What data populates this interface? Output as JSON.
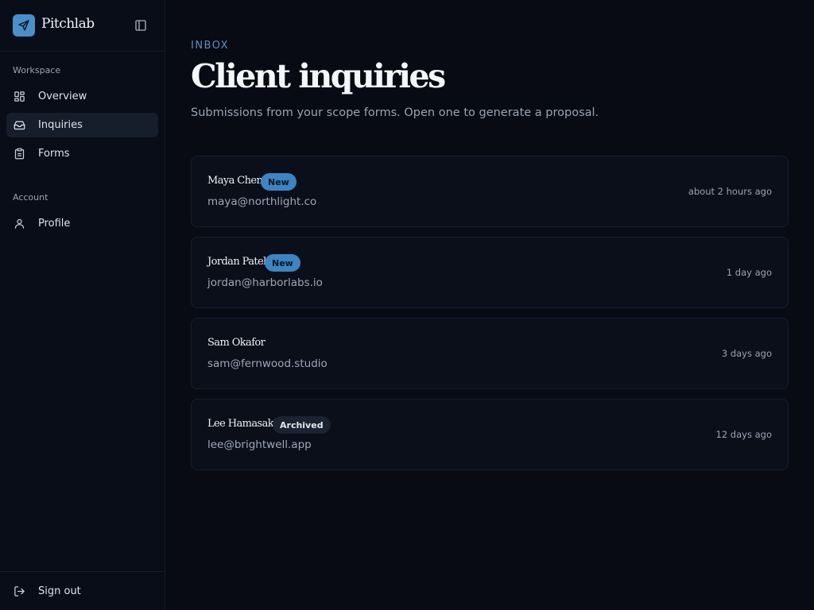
{
  "brand": {
    "name": "Pitchlab"
  },
  "sidebar": {
    "sections": [
      {
        "label": "Workspace",
        "items": [
          {
            "label": "Overview",
            "icon": "grid-icon"
          },
          {
            "label": "Inquiries",
            "icon": "inbox-icon",
            "active": true
          },
          {
            "label": "Forms",
            "icon": "clipboard-icon"
          }
        ]
      },
      {
        "label": "Account",
        "items": [
          {
            "label": "Profile",
            "icon": "user-icon"
          }
        ]
      }
    ],
    "footer": {
      "label": "Sign out",
      "icon": "sign-out-icon"
    }
  },
  "page": {
    "eyebrow": "INBOX",
    "title": "Client inquiries",
    "subtitle": "Submissions from your scope forms. Open one to generate a proposal."
  },
  "inquiries": [
    {
      "name": "Maya Chen",
      "badge": "New",
      "email": "maya@northlight.co",
      "time": "about 2 hours ago"
    },
    {
      "name": "Jordan Patel",
      "badge": "New",
      "email": "jordan@harborlabs.io",
      "time": "1 day ago"
    },
    {
      "name": "Sam Okafor",
      "badge": "",
      "email": "sam@fernwood.studio",
      "time": "3 days ago"
    },
    {
      "name": "Lee Hamasaki",
      "badge": "Archived",
      "email": "lee@brightwell.app",
      "time": "12 days ago"
    }
  ],
  "colors": {
    "accent": "#4a90c8",
    "badge_new": "#3d84c2",
    "badge_archived": "#1b2230",
    "background": "#080b14"
  }
}
